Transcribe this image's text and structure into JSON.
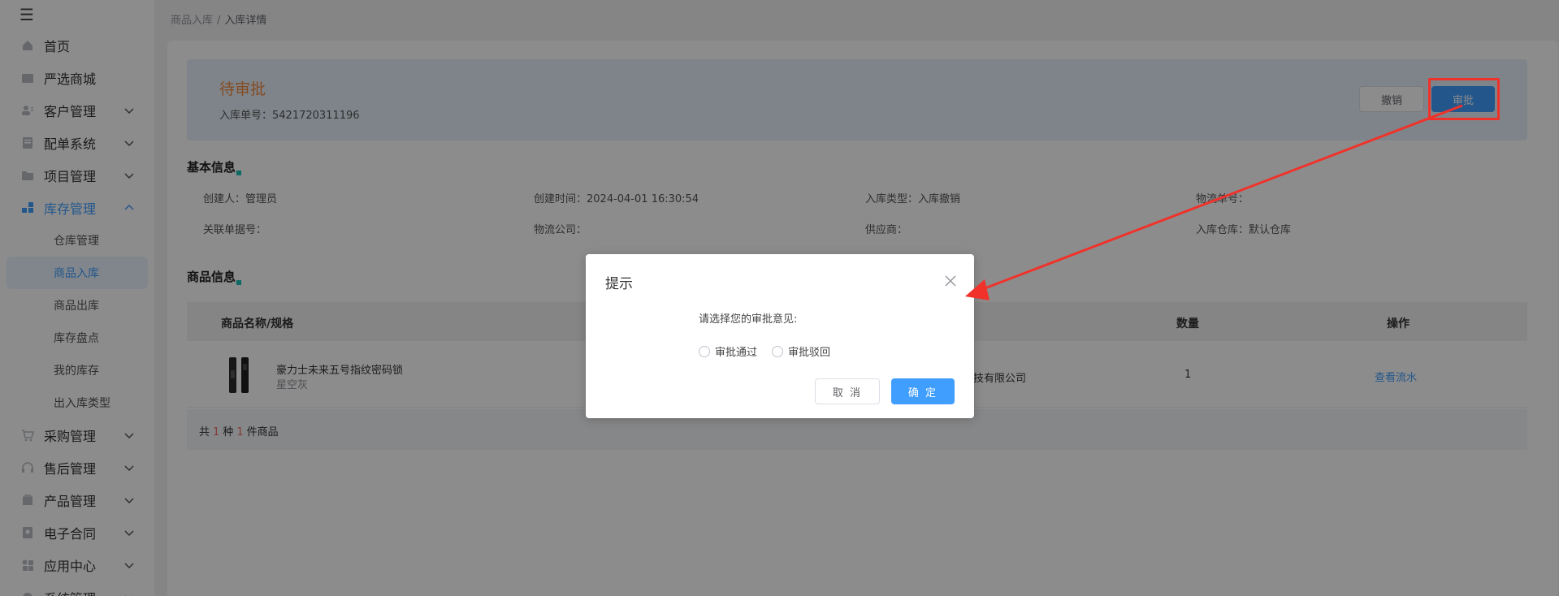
{
  "sidebar": {
    "items": [
      {
        "label": "首页",
        "icon": "home-icon",
        "expandable": false
      },
      {
        "label": "严选商城",
        "icon": "store-icon",
        "expandable": false
      },
      {
        "label": "客户管理",
        "icon": "customer-icon",
        "expandable": true
      },
      {
        "label": "配单系统",
        "icon": "order-icon",
        "expandable": true
      },
      {
        "label": "项目管理",
        "icon": "folder-icon",
        "expandable": true
      },
      {
        "label": "库存管理",
        "icon": "inventory-icon",
        "expandable": true,
        "expanded": true
      },
      {
        "label": "采购管理",
        "icon": "cart-icon",
        "expandable": true
      },
      {
        "label": "售后管理",
        "icon": "headset-icon",
        "expandable": true
      },
      {
        "label": "产品管理",
        "icon": "box-icon",
        "expandable": true
      },
      {
        "label": "电子合同",
        "icon": "contract-icon",
        "expandable": true
      },
      {
        "label": "应用中心",
        "icon": "apps-icon",
        "expandable": true
      },
      {
        "label": "系统管理",
        "icon": "system-icon",
        "expandable": true
      }
    ],
    "sub_items": [
      "仓库管理",
      "商品入库",
      "商品出库",
      "库存盘点",
      "我的库存",
      "出入库类型"
    ],
    "active_sub": "商品入库"
  },
  "breadcrumb": {
    "parent": "商品入库",
    "separator": "/",
    "current": "入库详情"
  },
  "header": {
    "status": "待审批",
    "order_no_label": "入库单号：",
    "order_no": "5421720311196",
    "revoke_label": "撤销",
    "approve_label": "审批"
  },
  "basic_info": {
    "title": "基本信息",
    "fields": [
      {
        "label": "创建人：",
        "value": "管理员"
      },
      {
        "label": "创建时间：",
        "value": "2024-04-01 16:30:54"
      },
      {
        "label": "入库类型：",
        "value": "入库撤销"
      },
      {
        "label": "物流单号：",
        "value": ""
      },
      {
        "label": "关联单据号：",
        "value": ""
      },
      {
        "label": "物流公司：",
        "value": ""
      },
      {
        "label": "供应商：",
        "value": ""
      },
      {
        "label": "入库仓库：",
        "value": "默认仓库"
      }
    ]
  },
  "product_info": {
    "title": "商品信息",
    "columns": [
      "商品名称/规格",
      "数量",
      "操作"
    ],
    "rows": [
      {
        "name": "豪力士未来五号指纹密码锁",
        "spec": "星空灰",
        "supplier": "能科技有限公司",
        "qty": "1",
        "action": "查看流水"
      }
    ],
    "footer": {
      "prefix": "共",
      "kinds": "1",
      "mid": "种",
      "count": "1",
      "suffix": "件商品"
    }
  },
  "dialog": {
    "title": "提示",
    "message": "请选择您的审批意见:",
    "options": [
      "审批通过",
      "审批驳回"
    ],
    "cancel_label": "取 消",
    "ok_label": "确 定"
  },
  "colors": {
    "primary": "#409eff",
    "status": "#f08a3c",
    "annotation": "#f0322a"
  }
}
